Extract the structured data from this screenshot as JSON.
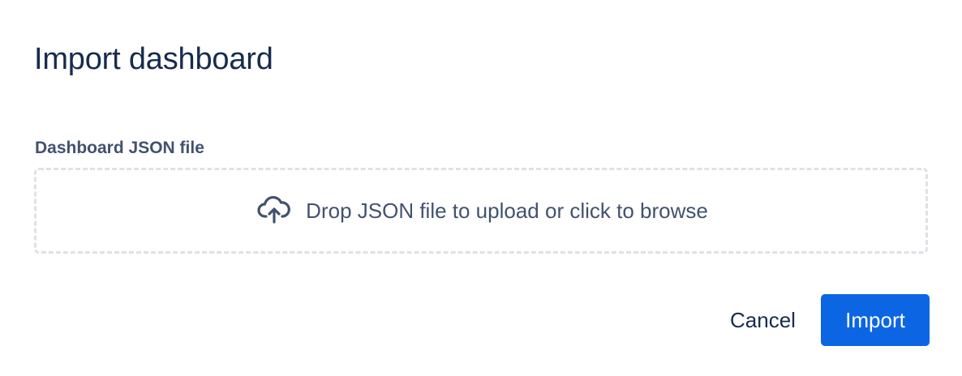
{
  "dialog": {
    "title": "Import dashboard"
  },
  "field": {
    "label": "Dashboard JSON file",
    "dropzone_icon": "cloud-upload-icon",
    "dropzone_text": "Drop JSON file to upload or click to browse"
  },
  "footer": {
    "cancel_label": "Cancel",
    "import_label": "Import"
  },
  "colors": {
    "title": "#172b4d",
    "label": "#42526e",
    "dropzone_border": "#dfe1e6",
    "primary": "#0c66e4"
  }
}
